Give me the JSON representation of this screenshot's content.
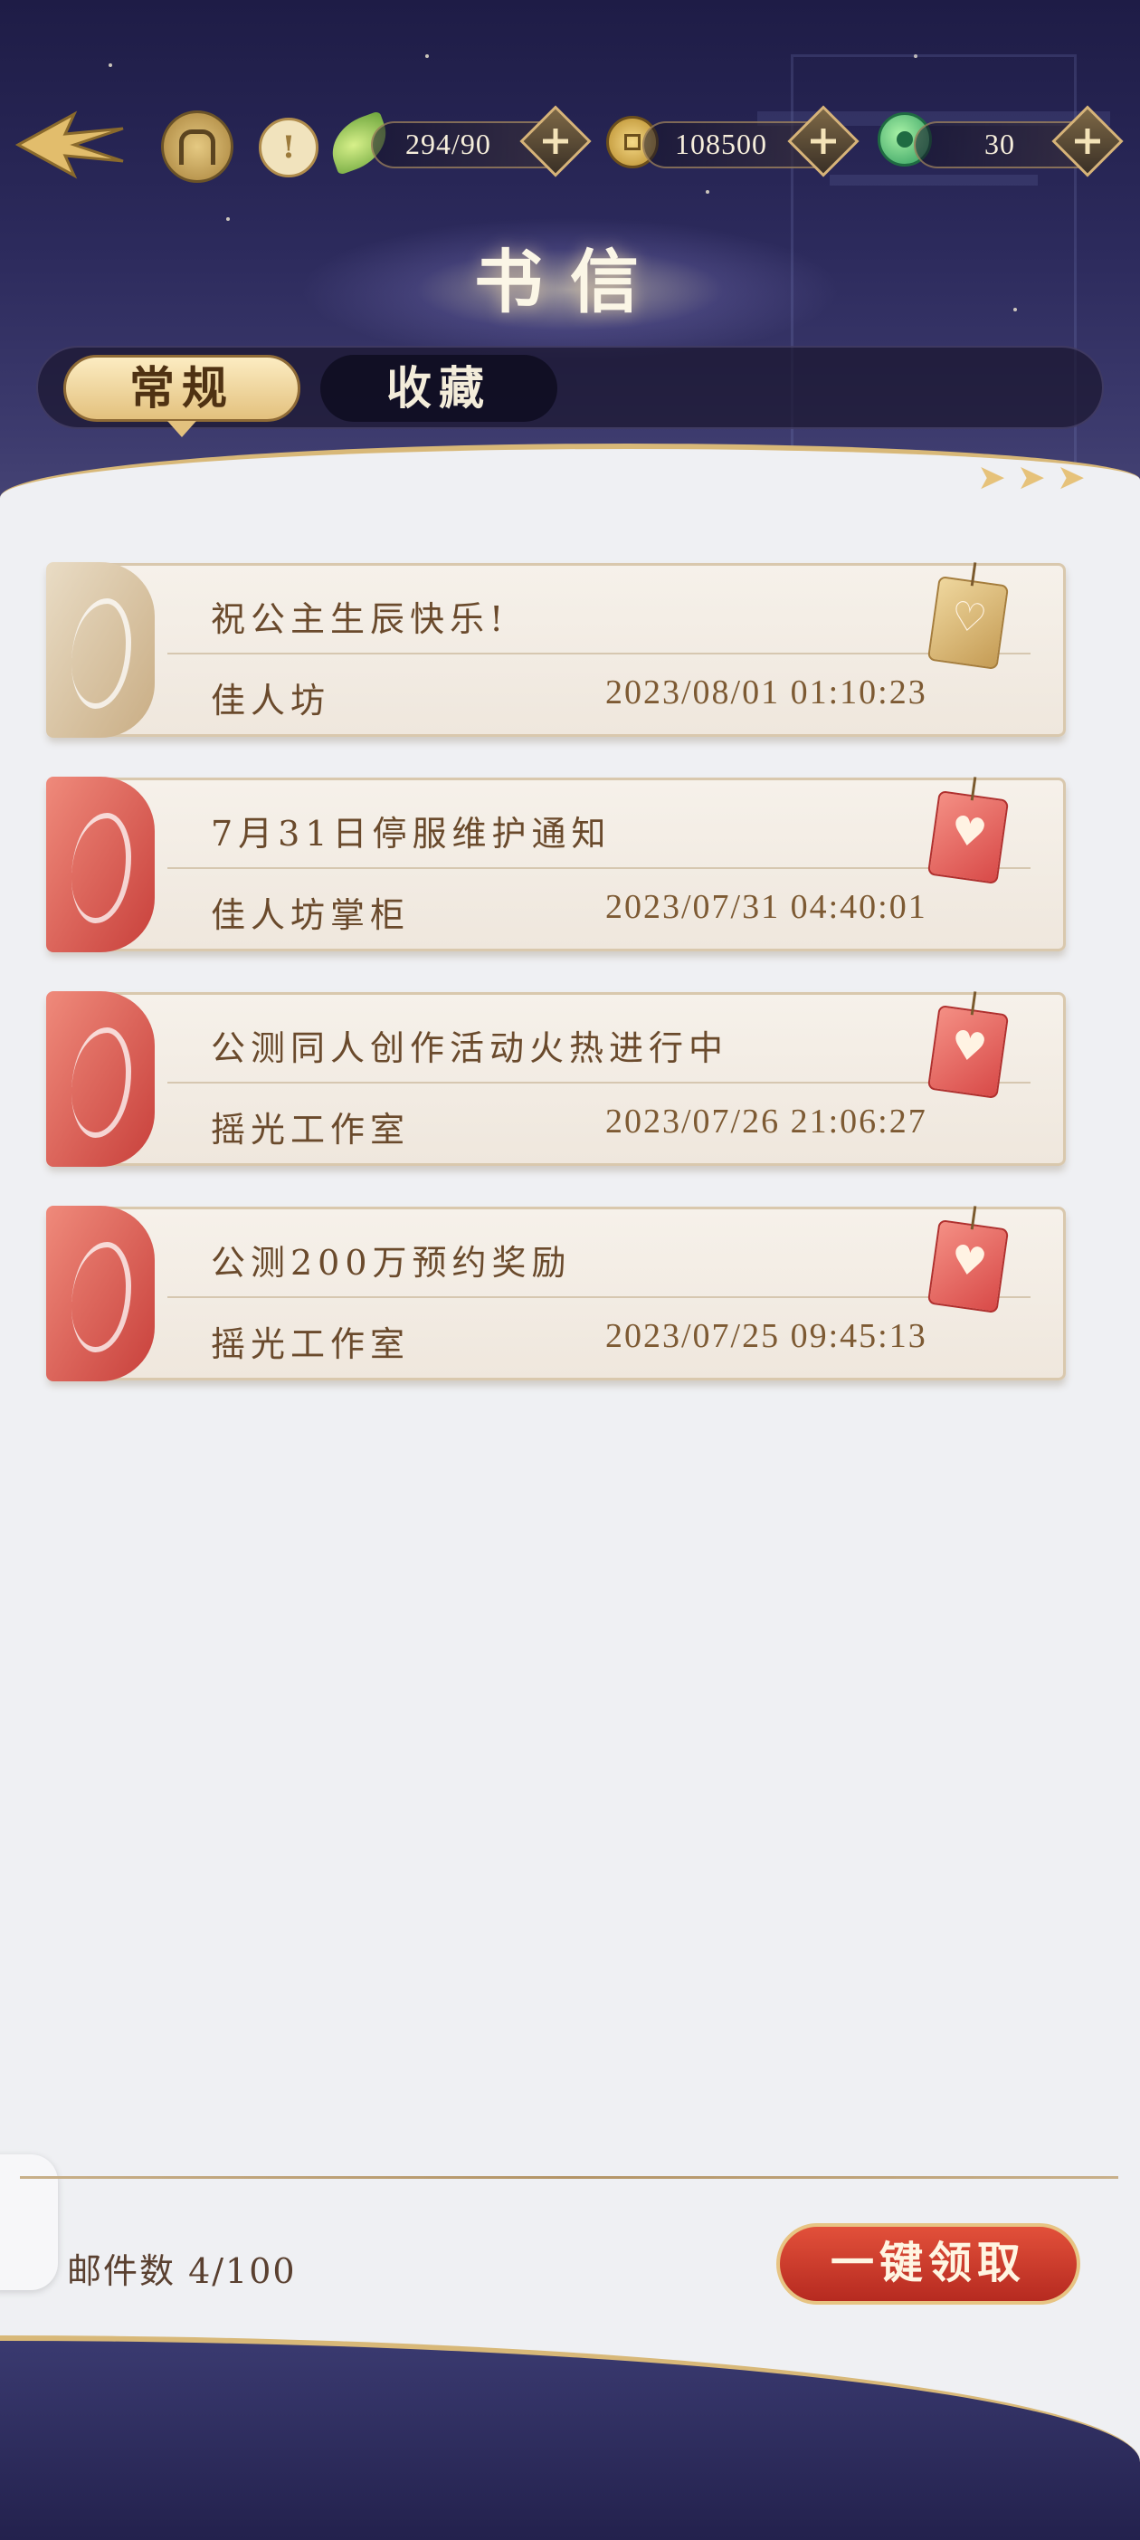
{
  "header": {
    "title": "书信",
    "resources": [
      {
        "name": "stamina",
        "value": "294/90",
        "icon": "leaf-icon"
      },
      {
        "name": "coins",
        "value": "108500",
        "icon": "coin-icon"
      },
      {
        "name": "jade",
        "value": "30",
        "icon": "jade-icon"
      }
    ]
  },
  "tabs": [
    {
      "label": "常规",
      "active": true
    },
    {
      "label": "收藏",
      "active": false
    }
  ],
  "mails": [
    {
      "subject": "祝公主生辰快乐!",
      "sender": "佳人坊",
      "time": "2023/08/01 01:10:23",
      "read": true
    },
    {
      "subject": "7月31日停服维护通知",
      "sender": "佳人坊掌柜",
      "time": "2023/07/31 04:40:01",
      "read": false
    },
    {
      "subject": "公测同人创作活动火热进行中",
      "sender": "摇光工作室",
      "time": "2023/07/26 21:06:27",
      "read": false
    },
    {
      "subject": "公测200万预约奖励",
      "sender": "摇光工作室",
      "time": "2023/07/25 09:45:13",
      "read": false
    }
  ],
  "footer": {
    "mail_count": "邮件数 4/100",
    "claim_all_label": "一键领取"
  },
  "colors": {
    "header_bg": "#2c2a5c",
    "accent_gold": "#d8b878",
    "claim_red": "#c83a2a",
    "text_brown": "#6a4a2c"
  }
}
